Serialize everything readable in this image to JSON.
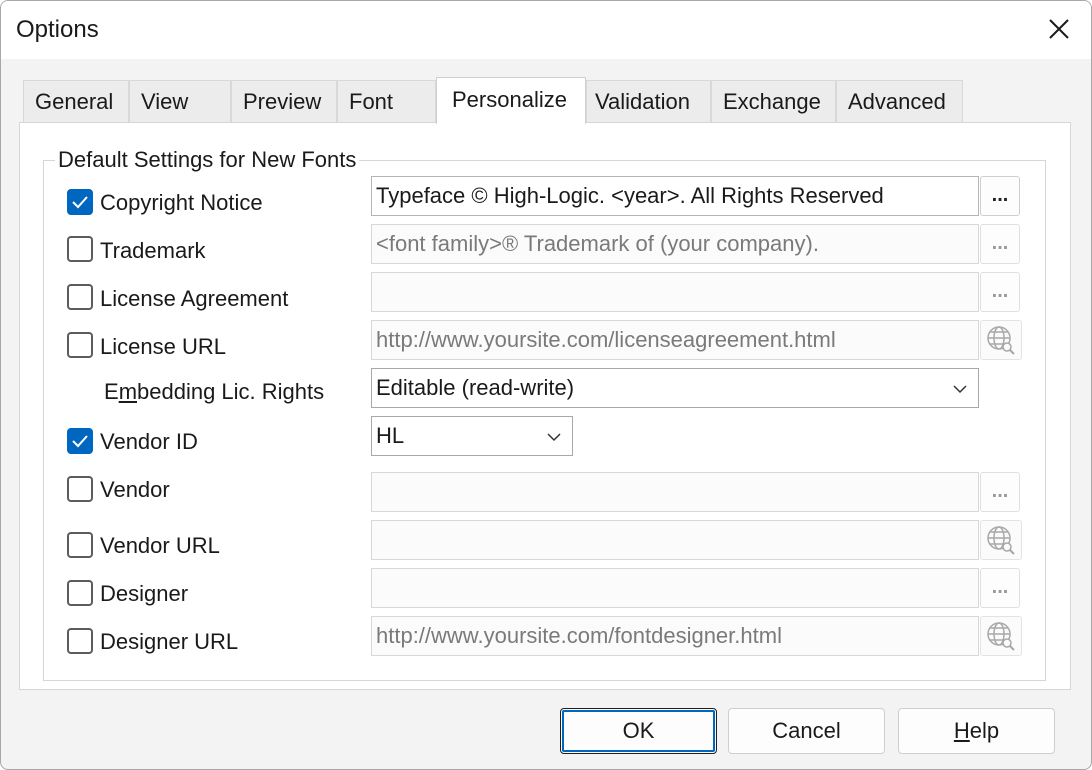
{
  "window": {
    "title": "Options"
  },
  "tabs": [
    {
      "label": "General"
    },
    {
      "label": "View"
    },
    {
      "label": "Preview"
    },
    {
      "label": "Font"
    },
    {
      "label": "Personalize"
    },
    {
      "label": "Validation"
    },
    {
      "label": "Exchange"
    },
    {
      "label": "Advanced"
    }
  ],
  "active_tab": "Personalize",
  "group": {
    "title": "Default Settings for New Fonts"
  },
  "rows": {
    "copyright": {
      "label": "Copyright Notice",
      "checked": true,
      "value": "Typeface © High-Logic. <year>. All Rights Reserved"
    },
    "trademark": {
      "label": "Trademark",
      "checked": false,
      "placeholder": "<font family>® Trademark of (your company)."
    },
    "license_agreement": {
      "label": "License Agreement",
      "checked": false,
      "value": ""
    },
    "license_url": {
      "label": "License URL",
      "checked": false,
      "placeholder": "http://www.yoursite.com/licenseagreement.html"
    },
    "embedding": {
      "label_pre": "E",
      "label_ul": "m",
      "label_post": "bedding Lic. Rights",
      "value": "Editable (read-write)"
    },
    "vendor_id": {
      "label": "Vendor ID",
      "checked": true,
      "value": "HL"
    },
    "vendor": {
      "label": "Vendor",
      "checked": false,
      "value": ""
    },
    "vendor_url": {
      "label": "Vendor URL",
      "checked": false,
      "value": ""
    },
    "designer": {
      "label": "Designer",
      "checked": false,
      "value": ""
    },
    "designer_url": {
      "label": "Designer URL",
      "checked": false,
      "placeholder": "http://www.yoursite.com/fontdesigner.html"
    }
  },
  "ellipsis": "...",
  "buttons": {
    "ok": "OK",
    "cancel": "Cancel",
    "help_ul": "H",
    "help_rest": "elp"
  },
  "colors": {
    "accent": "#0067c0",
    "panel_bg": "#ffffff",
    "window_bg": "#f3f3f3"
  },
  "icons": {
    "close": "close-icon",
    "check": "checkmark-icon",
    "ellipsis": "ellipsis-icon",
    "globe": "globe-search-icon",
    "dropdown": "chevron-down-icon"
  }
}
